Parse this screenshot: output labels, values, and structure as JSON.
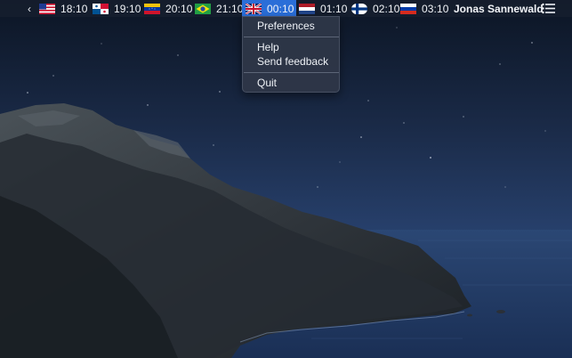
{
  "menubar": {
    "back_chevron": "‹",
    "clocks": [
      {
        "flag": "us-flag-icon",
        "time": "18:10",
        "active": false
      },
      {
        "flag": "panama-flag-icon",
        "time": "19:10",
        "active": false
      },
      {
        "flag": "venezuela-flag-icon",
        "time": "20:10",
        "active": false
      },
      {
        "flag": "brazil-flag-icon",
        "time": "21:10",
        "active": false
      },
      {
        "flag": "uk-flag-icon",
        "time": "00:10",
        "active": true
      },
      {
        "flag": "netherlands-flag-icon",
        "time": "01:10",
        "active": false
      },
      {
        "flag": "finland-flag-icon",
        "time": "02:10",
        "active": false
      },
      {
        "flag": "russia-flag-icon",
        "time": "03:10",
        "active": false
      }
    ],
    "user_name": "Jonas Sannewald",
    "list_icon": "list-icon"
  },
  "dropdown": {
    "items": [
      {
        "label": "Preferences"
      },
      {
        "label": "Help"
      },
      {
        "label": "Send feedback"
      },
      {
        "label": "Quit"
      }
    ]
  },
  "colors": {
    "menubar_bg": "#161e2e",
    "active_highlight": "#2a6ed8",
    "menu_bg": "#2e3748",
    "sky_dark": "#0e1728",
    "sea": "#27406b"
  }
}
